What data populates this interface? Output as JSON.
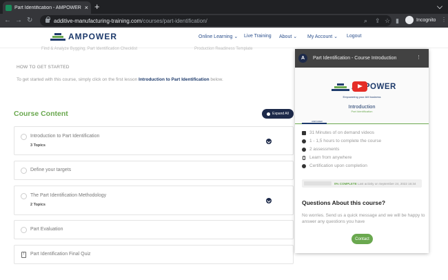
{
  "browser": {
    "tab_title": "Part Identification - AMPOWER",
    "url_host": "additive-manufacturing-training.com",
    "url_path": "/courses/part-identification/",
    "profile_label": "Incognito"
  },
  "site": {
    "logo_text": "AMPOWER",
    "menu": [
      "Online Learning",
      "Live Training",
      "About",
      "My Account",
      "Logout"
    ]
  },
  "page": {
    "faded_left": "Find & Analyze Bygging, Part Identification Checklist",
    "faded_right": "Production Readiness Template",
    "howto_heading": "HOW TO GET STARTED",
    "howto_text_before": "To get started with this course, simply click on the first lesson ",
    "howto_link": "Introduction to Part Identification",
    "howto_text_after": " below.",
    "course_content_title": "Course Content",
    "expand_all": "Expand All",
    "lessons": [
      {
        "title": "Introduction to Part Identification",
        "topics": "3 Topics"
      },
      {
        "title": "Define your targets"
      },
      {
        "title": "The Part Identification Methodology",
        "topics": "2 Topics"
      },
      {
        "title": "Part Evaluation"
      },
      {
        "title": "Part Identification Final Quiz"
      }
    ]
  },
  "sidebar": {
    "video": {
      "avatar": "A",
      "title": "Part Identification - Course Introduction",
      "logo_text": "AMPOWER",
      "tagline": "Empowering your AM business",
      "intro": "Introduction",
      "sub": "Part Identification",
      "tab_label": "AMPOWER"
    },
    "features": [
      "31 Minutes of on demand videos",
      "1 - 1,5 hours to complete the course",
      "2 assessments",
      "Learn from anywhere",
      "Certification upon completion"
    ],
    "progress": {
      "percent_label": "0% COMPLETE",
      "last_activity": "Last activity on September 24, 2022 16:34"
    },
    "questions_title": "Questions About this course?",
    "questions_text": "No worries. Send us a quick message and we will be happy to answer any questions you have",
    "contact_label": "Contact"
  },
  "colors": {
    "brand_navy": "#1d3a6b",
    "accent_green": "#6aa84f",
    "button_dark": "#1d2a4a"
  }
}
